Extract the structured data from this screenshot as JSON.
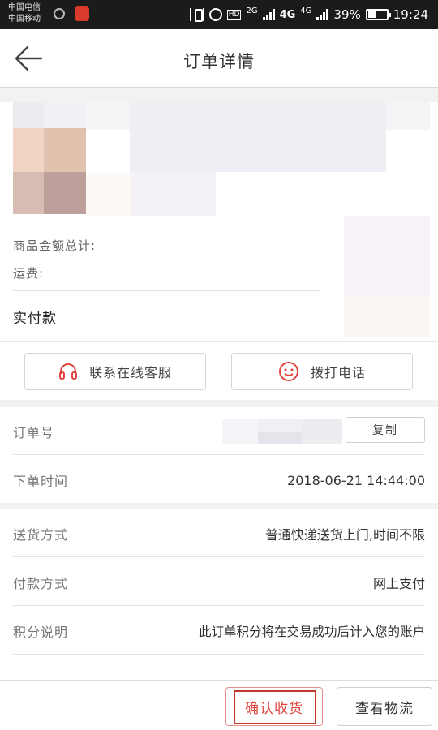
{
  "status_bar": {
    "carrier1": "中国电信",
    "carrier2": "中国移动",
    "hd": "HD",
    "net1": "2G",
    "net2": "4G",
    "net3": "4G",
    "battery": "39%",
    "time": "19:24"
  },
  "header": {
    "title": "订单详情",
    "back_icon": "arrow-left-icon"
  },
  "product": {
    "total_label": "商品金额总计:",
    "shipping_label": "运费:",
    "paid_label": "实付款"
  },
  "actions": {
    "service_label": "联系在线客服",
    "service_icon": "headset-icon",
    "call_label": "拨打电话",
    "call_icon": "smiley-icon",
    "accent": "#e0443d"
  },
  "order": {
    "number_label": "订单号",
    "copy_label": "复制",
    "time_label": "下单时间",
    "time_value": "2018-06-21  14:44:00"
  },
  "delivery": {
    "method_label": "送货方式",
    "method_value": "普通快递送货上门,时间不限",
    "payment_label": "付款方式",
    "payment_value": "网上支付",
    "points_label": "积分说明",
    "points_value": "此订单积分将在交易成功后计入您的账户"
  },
  "bottom": {
    "confirm_label": "确认收货",
    "logistics_label": "查看物流"
  }
}
